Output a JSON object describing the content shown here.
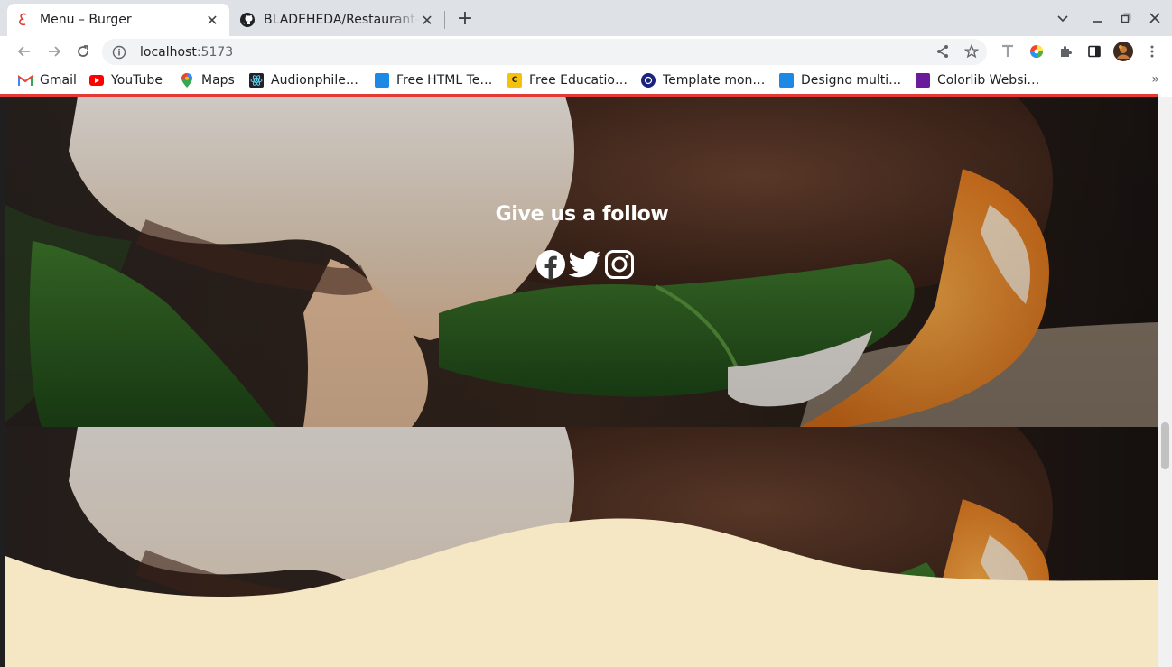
{
  "tabs": [
    {
      "title": "Menu – Burger",
      "close": "✕"
    },
    {
      "title": "BLADEHEDA/Restaurant-",
      "close": "✕"
    }
  ],
  "new_tab": "+",
  "window_controls": {
    "dropdown": "⌄",
    "minimize": "—",
    "restore": "❐",
    "close": "✕"
  },
  "nav": {
    "back": "←",
    "forward": "→",
    "reload": "↻"
  },
  "address": {
    "host": "localhost",
    "port": ":5173"
  },
  "bookmarks": [
    {
      "label": "Gmail",
      "icon": "gmail-icon",
      "color": "#ea4335"
    },
    {
      "label": "YouTube",
      "icon": "youtube-icon",
      "color": "#ff0000"
    },
    {
      "label": "Maps",
      "icon": "maps-icon",
      "color": "#34a853"
    },
    {
      "label": "Audionphile…",
      "icon": "react-icon",
      "color": "#20232a"
    },
    {
      "label": "Free HTML Te…",
      "icon": "freehtml-icon",
      "color": "#1e88e5"
    },
    {
      "label": "Free Educatio…",
      "icon": "education-icon",
      "color": "#f4c20d"
    },
    {
      "label": "Template mon…",
      "icon": "templatemonster-icon",
      "color": "#1a237e"
    },
    {
      "label": "Designo multi…",
      "icon": "designo-icon",
      "color": "#1e88e5"
    },
    {
      "label": "Colorlib Websi…",
      "icon": "colorlib-icon",
      "color": "#6a1b9a"
    }
  ],
  "bookmarks_more": "»",
  "page": {
    "follow_heading": "Give us a follow",
    "socials": [
      "facebook-icon",
      "twitter-icon",
      "instagram-icon"
    ],
    "accent": "#e53935",
    "cream": "#f5e6c4"
  }
}
